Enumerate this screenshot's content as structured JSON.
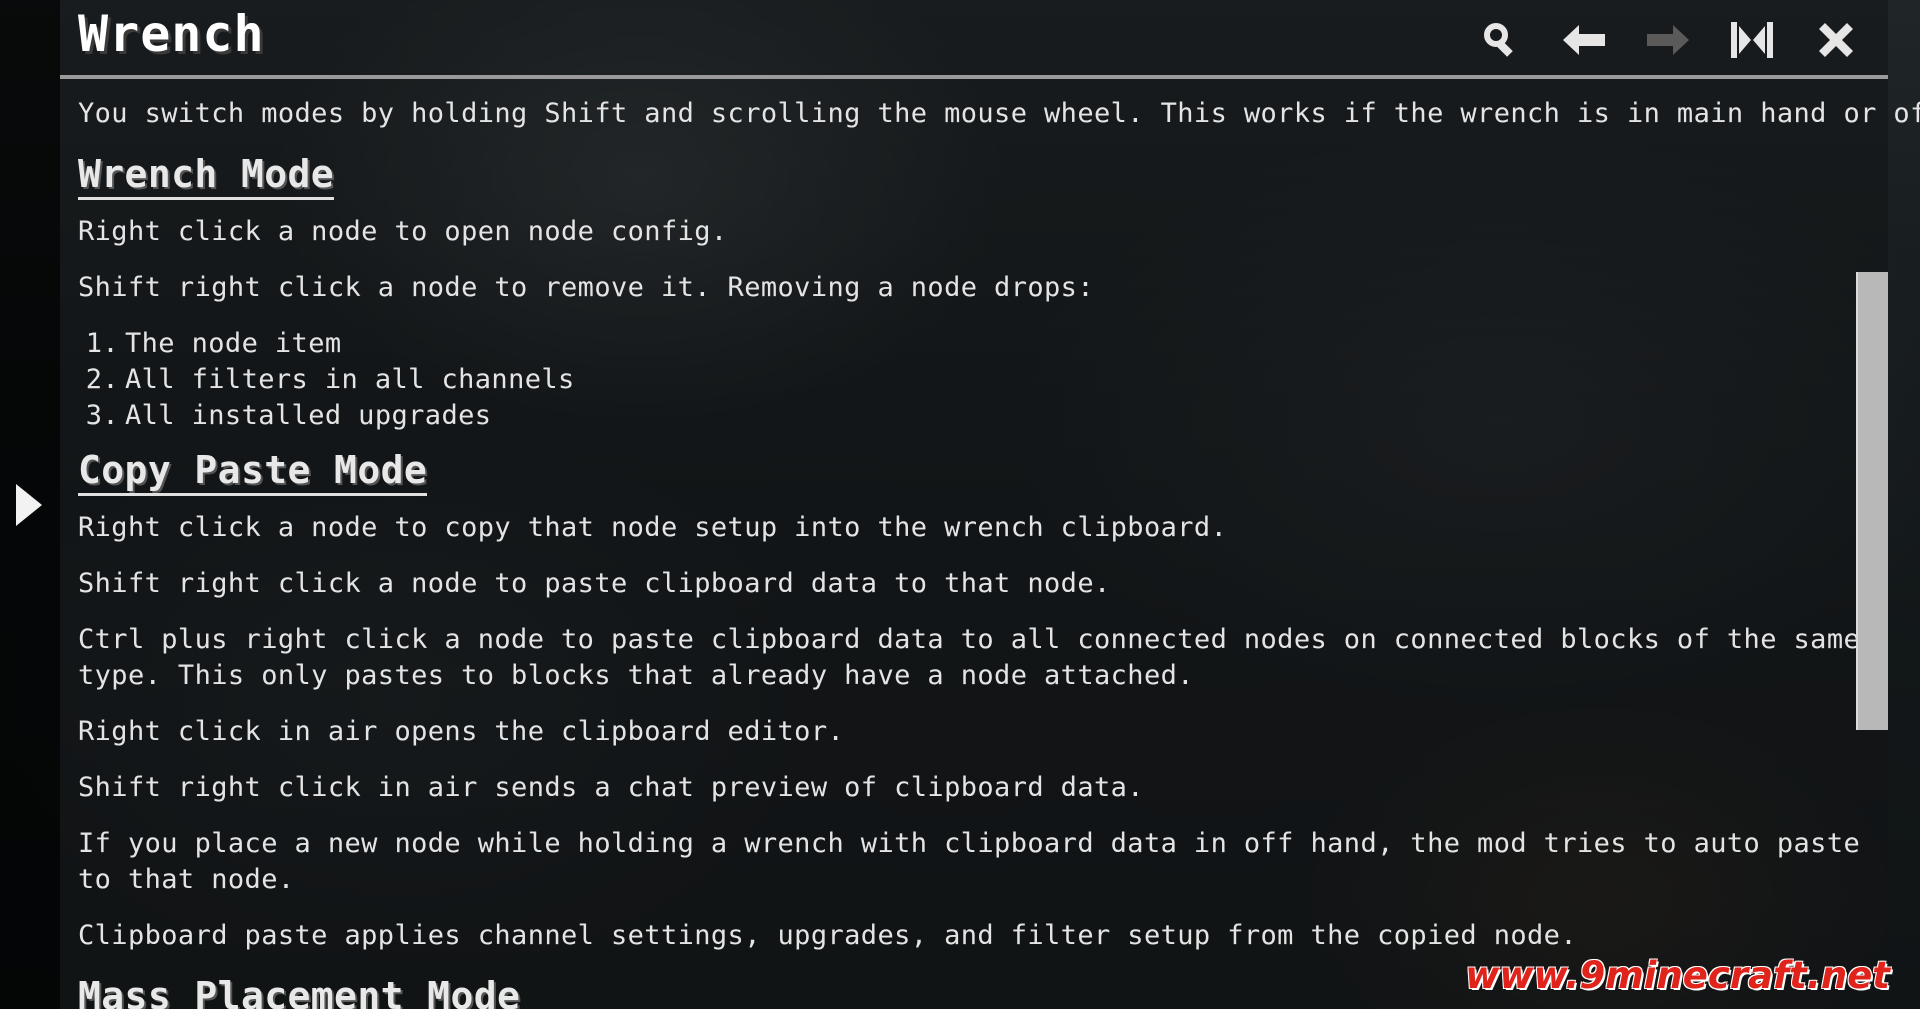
{
  "page": {
    "title": "Wrench"
  },
  "toolbar": {
    "search": "search-icon",
    "back": "arrow-left-icon",
    "forward": "arrow-right-icon",
    "collapse": "collapse-icon",
    "close": "close-icon"
  },
  "content": {
    "intro": "You switch modes by holding Shift and scrolling the mouse wheel. This works if the wrench is in main hand or off hand.",
    "sections": [
      {
        "heading": "Wrench Mode",
        "paragraphs": [
          "Right click a node to open node config.",
          "Shift right click a node to remove it. Removing a node drops:"
        ],
        "list": [
          {
            "num": "1.",
            "text": "The node item"
          },
          {
            "num": "2.",
            "text": "All filters in all channels"
          },
          {
            "num": "3.",
            "text": "All installed upgrades"
          }
        ]
      },
      {
        "heading": "Copy Paste Mode",
        "paragraphs": [
          "Right click a node to copy that node setup into the wrench clipboard.",
          "Shift right click a node to paste clipboard data to that node.",
          "Ctrl plus right click a node to paste clipboard data to all connected nodes on connected blocks of the same type. This only pastes to blocks that already have a node attached.",
          "Right click in air opens the clipboard editor.",
          "Shift right click in air sends a chat preview of clipboard data.",
          "If you place a new node while holding a wrench with clipboard data in off hand, the mod tries to auto paste to that node.",
          "Clipboard paste applies channel settings, upgrades, and filter setup from the copied node."
        ]
      },
      {
        "heading": "Mass Placement Mode"
      }
    ]
  },
  "scroll": {
    "position": 0.12
  },
  "watermark": "www.9minecraft.net",
  "colors": {
    "text": "#e4e4e4",
    "title": "#ffffff",
    "scrollbar": "#b8b8b8",
    "watermark": "#e0231b"
  }
}
